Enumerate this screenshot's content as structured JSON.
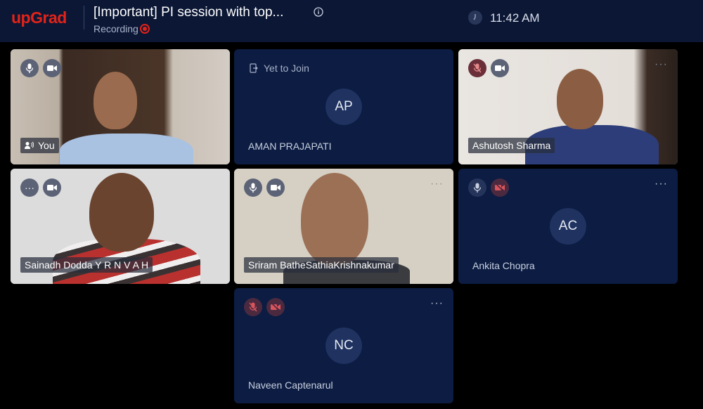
{
  "header": {
    "logo": "upGrad",
    "title": "[Important] PI session with top...",
    "recording_label": "Recording",
    "time": "11:42 AM"
  },
  "tiles": [
    {
      "name": "You",
      "state": "video",
      "mic": "on",
      "cam": "on"
    },
    {
      "name": "AMAN PRAJAPATI",
      "state": "yet-to-join",
      "status": "Yet to Join",
      "initials": "AP"
    },
    {
      "name": "Ashutosh Sharma",
      "state": "video",
      "mic": "off",
      "cam": "on"
    },
    {
      "name": "Sainadh Dodda Y R N V A H",
      "state": "video",
      "cam": "on"
    },
    {
      "name": "Sriram BatheSathiaKrishnakumar",
      "state": "video",
      "mic": "on",
      "cam": "on"
    },
    {
      "name": "Ankita Chopra",
      "state": "no-video",
      "initials": "AC",
      "mic": "on",
      "cam": "off"
    },
    {
      "name": "Naveen Captenarul",
      "state": "no-video",
      "initials": "NC",
      "mic": "off",
      "cam": "off"
    }
  ],
  "more_glyph": "···",
  "colors": {
    "brand": "#e2231a",
    "header_bg": "#0b1735",
    "tile_bg": "#0c1c42"
  }
}
